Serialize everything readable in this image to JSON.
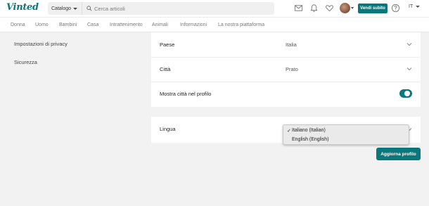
{
  "header": {
    "logo": "Vinted",
    "catalog_label": "Catalogo",
    "search_placeholder": "Cerca articoli",
    "sell_button": "Vendi subito",
    "language": "IT",
    "icons": [
      "mail-icon",
      "bell-icon",
      "heart-icon",
      "avatar",
      "help-icon"
    ]
  },
  "categories": [
    "Donna",
    "Uomo",
    "Bambini",
    "Casa",
    "Intrattenimento",
    "Animali",
    "Informazioni",
    "La nostra piattaforma"
  ],
  "sidebar": {
    "items": [
      {
        "label": "Impostazioni di privacy"
      },
      {
        "label": "Sicurezza"
      }
    ]
  },
  "profile": {
    "country": {
      "label": "Paese",
      "value": "Italia"
    },
    "city": {
      "label": "Città",
      "value": "Prato"
    },
    "show_city": {
      "label": "Mostra città nel profilo",
      "enabled": true
    },
    "language": {
      "label": "Lingua",
      "options": [
        {
          "label": "Italiano (Italian)",
          "checked": true,
          "check_mark": "✓"
        },
        {
          "label": "English (English)",
          "checked": false,
          "check_mark": ""
        }
      ]
    },
    "update_button": "Aggiorna profilo"
  },
  "colors": {
    "brand": "#09777b",
    "background": "#f2f2f2"
  }
}
